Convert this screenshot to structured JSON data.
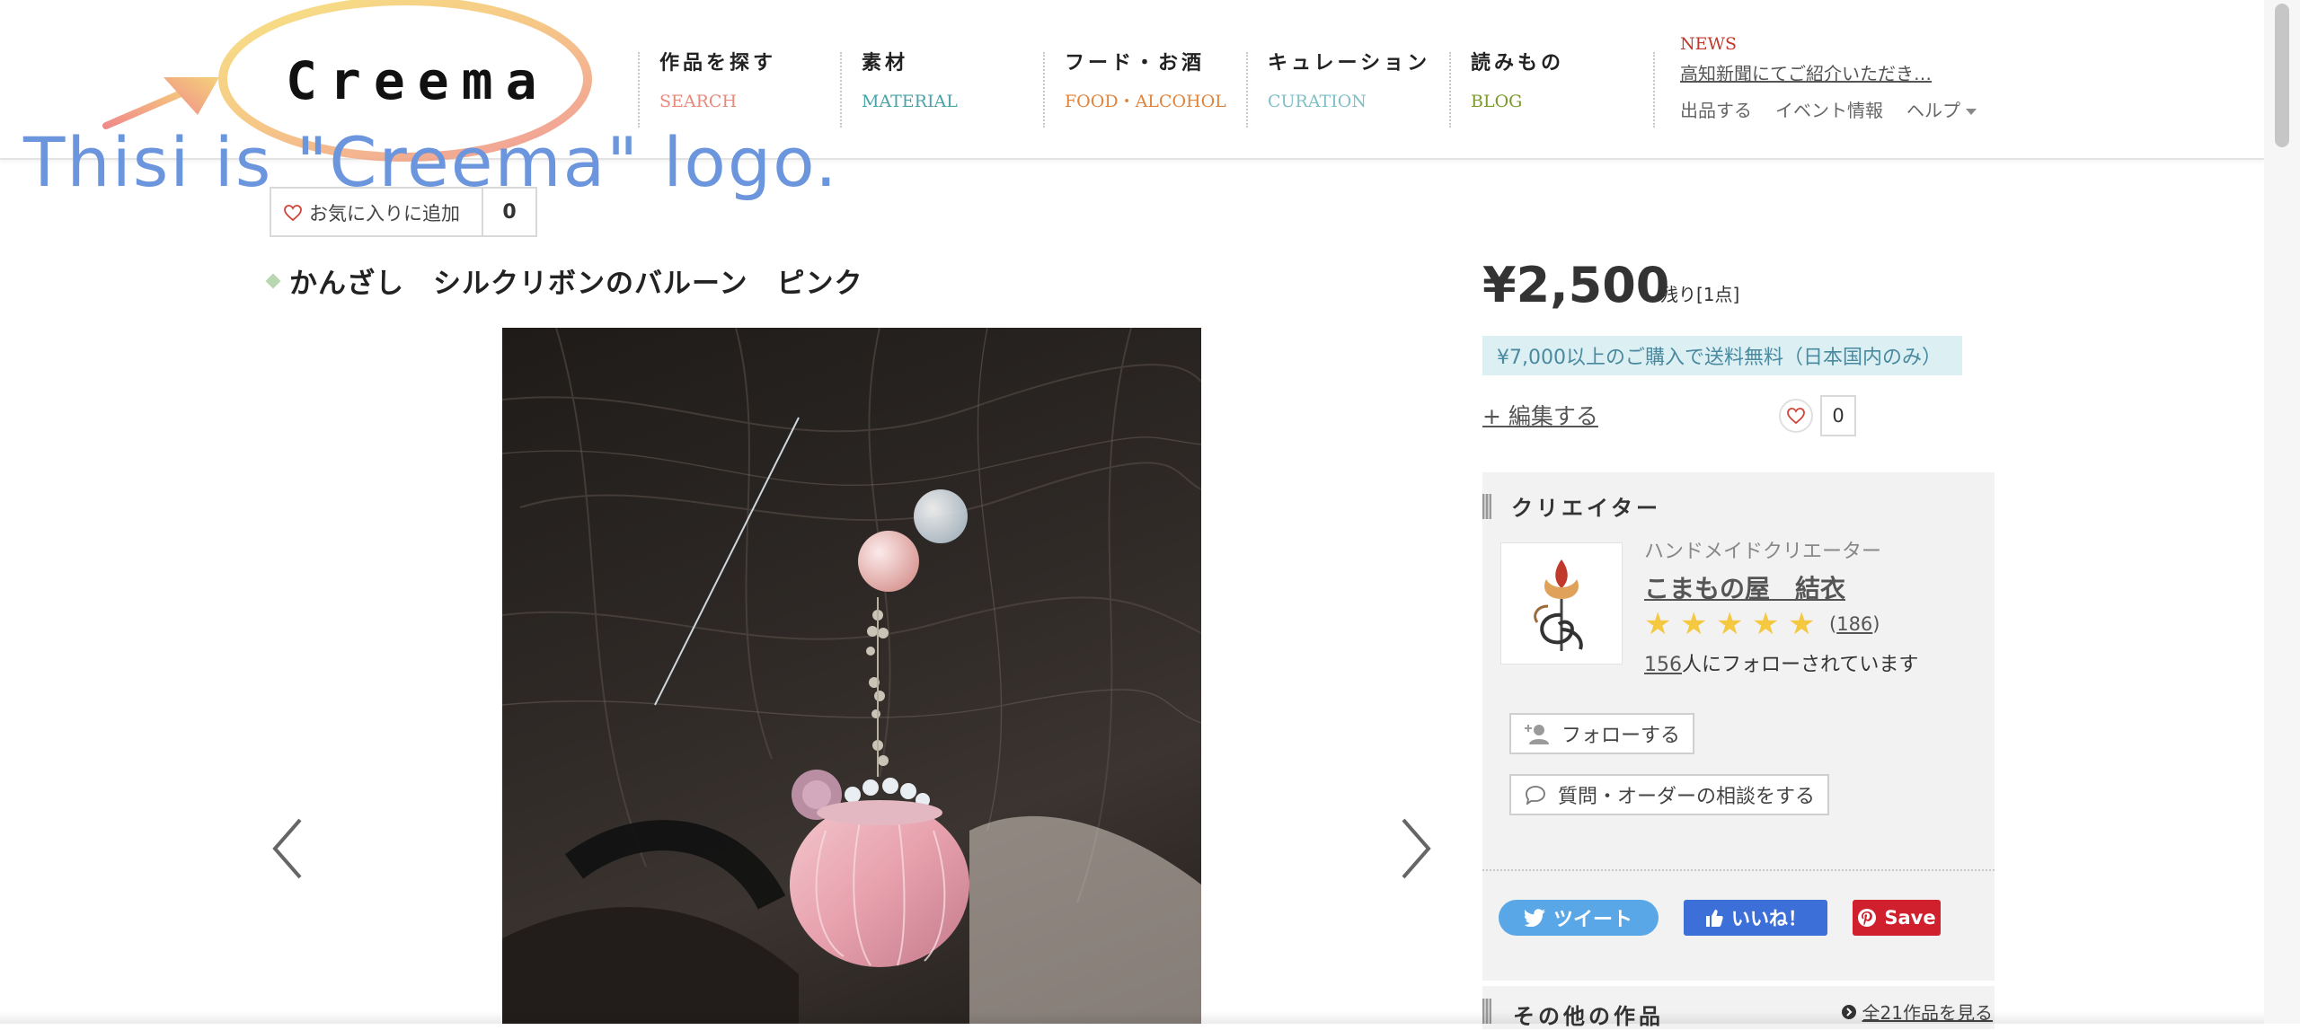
{
  "header": {
    "logo_text": "Creema",
    "nav": [
      {
        "ja": "作品を探す",
        "en": "SEARCH",
        "en_color": "#e58a7c"
      },
      {
        "ja": "素材",
        "en": "MATERIAL",
        "en_color": "#4aa3a8"
      },
      {
        "ja": "フード・お酒",
        "en": "FOOD・ALCOHOL",
        "en_color": "#e0843c"
      },
      {
        "ja": "キュレーション",
        "en": "CURATION",
        "en_color": "#7fc0c6"
      },
      {
        "ja": "読みもの",
        "en": "BLOG",
        "en_color": "#7a9a2a"
      }
    ],
    "news_label": "NEWS",
    "news_text": "高知新聞にてご紹介いただき…",
    "util_links": [
      "出品する",
      "イベント情報",
      "ヘルプ"
    ]
  },
  "annotation": {
    "text": "Thisi is \"Creema\"   logo."
  },
  "favorite": {
    "label": "お気に入りに追加",
    "count": "0"
  },
  "product": {
    "title": "かんざし　シルクリボンのバルーン　ピンク",
    "price": "¥2,500",
    "stock": "残り[1点]",
    "shipping_note": "¥7,000以上のご購入で送料無料（日本国内のみ）",
    "edit_label": "+ 編集する",
    "like_count": "0"
  },
  "creator": {
    "section_title": "クリエイター",
    "type": "ハンドメイドクリエーター",
    "name": "こまもの屋　結衣",
    "rating": 5,
    "review_count_open": "(",
    "review_count": "186",
    "review_count_close": ")",
    "followers_count": "156",
    "followers_suffix": "人にフォローされています",
    "follow_button": "フォローする",
    "inquiry_button": "質問・オーダーの相談をする"
  },
  "sns": {
    "tweet": "ツイート",
    "like": "いいね！",
    "save": "Save"
  },
  "other_works": {
    "title": "その他の作品",
    "link": "全21作品を見る"
  },
  "colors": {
    "accent_blue": "#6b95dc",
    "shipping_bg": "#dceff3",
    "twitter": "#5aa7e8",
    "facebook": "#3c6fd8",
    "pinterest": "#d0202e",
    "star": "#f5c842"
  }
}
